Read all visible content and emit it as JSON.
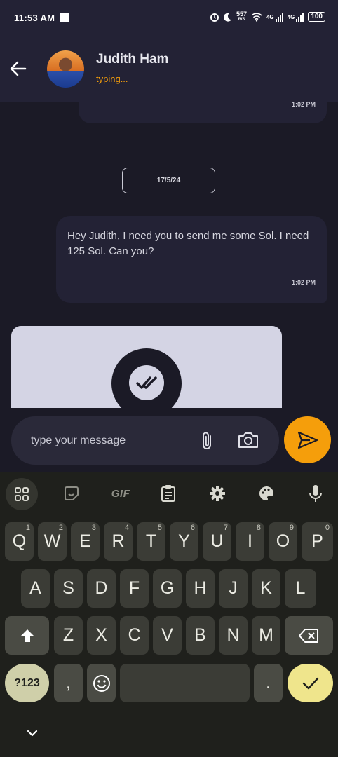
{
  "status_bar": {
    "time": "11:53 AM",
    "net_speed_top": "557",
    "net_speed_unit": "B/S",
    "signal1_label": "4G",
    "signal2_label": "4G",
    "battery": "100"
  },
  "header": {
    "contact_name": "Judith Ham",
    "contact_status": "typing..."
  },
  "chat": {
    "previous_message_time": "1:02 PM",
    "date_separator": "17/5/24",
    "messages": [
      {
        "text": "Hey Judith, I need you to send me some Sol. I need 125 Sol. Can you?",
        "time": "1:02 PM",
        "direction": "outgoing"
      }
    ]
  },
  "composer": {
    "placeholder": "type your message"
  },
  "keyboard": {
    "toolbar": {
      "gif_label": "GIF"
    },
    "row1": [
      {
        "key": "Q",
        "hint": "1"
      },
      {
        "key": "W",
        "hint": "2"
      },
      {
        "key": "E",
        "hint": "3"
      },
      {
        "key": "R",
        "hint": "4"
      },
      {
        "key": "T",
        "hint": "5"
      },
      {
        "key": "Y",
        "hint": "6"
      },
      {
        "key": "U",
        "hint": "7"
      },
      {
        "key": "I",
        "hint": "8"
      },
      {
        "key": "O",
        "hint": "9"
      },
      {
        "key": "P",
        "hint": "0"
      }
    ],
    "row2": [
      "A",
      "S",
      "D",
      "F",
      "G",
      "H",
      "J",
      "K",
      "L"
    ],
    "row3": [
      "Z",
      "X",
      "C",
      "V",
      "B",
      "N",
      "M"
    ],
    "symbols_label": "?123",
    "comma_label": ",",
    "period_label": "."
  },
  "colors": {
    "background": "#1b1a26",
    "surface": "#232235",
    "accent": "#f59e0b",
    "keyboard_bg": "#1f201c"
  }
}
